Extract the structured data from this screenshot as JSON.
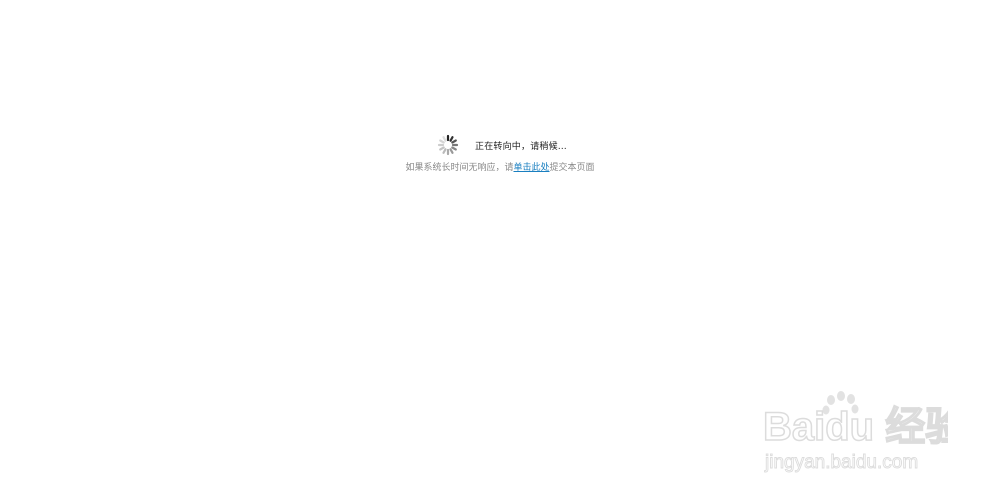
{
  "loading": {
    "message": "正在转向中，请稍候…",
    "icon": "spinner-icon"
  },
  "hint": {
    "prefix": "如果系统长时间无响应，请",
    "link_label": "单击此处",
    "suffix": "提交本页面"
  },
  "watermark": {
    "brand_text": "Baidu 经验",
    "url": "jingyan.baidu.com"
  },
  "colors": {
    "link": "#1a7fc0",
    "hint_text": "#888888",
    "message_text": "#222222",
    "watermark": "#dcdcdc"
  }
}
